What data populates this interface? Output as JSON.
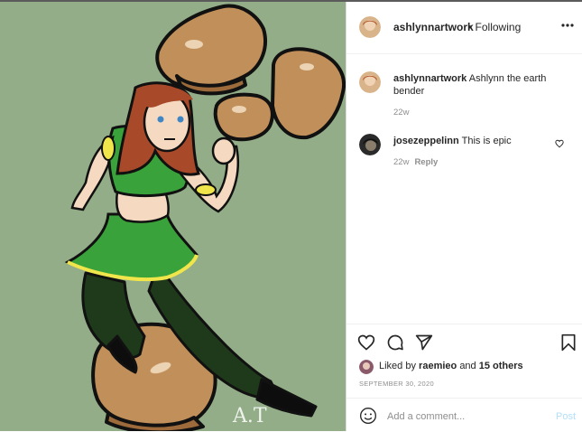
{
  "colors": {
    "art_background": "#93ad88",
    "link_blue_disabled": "#b2dffc",
    "muted_text": "#8e8e8e"
  },
  "header": {
    "username": "ashlynnartwork",
    "separator": "•",
    "follow_status": "Following",
    "more_icon": "more-horizontal-icon"
  },
  "artwork": {
    "signature": "A.T"
  },
  "comments": [
    {
      "username": "ashlynnartwork",
      "text": "Ashlynn the earth bender",
      "age": "22w",
      "reply_label": ""
    },
    {
      "username": "josezeppelinn",
      "text": "This is epic",
      "age": "22w",
      "reply_label": "Reply"
    }
  ],
  "actions": {
    "like_icon": "heart-icon",
    "comment_icon": "comment-icon",
    "share_icon": "share-icon",
    "save_icon": "bookmark-icon"
  },
  "likes": {
    "prefix": "Liked by",
    "user": "raemieo",
    "middle": "and",
    "others": "15 others"
  },
  "date": "SEPTEMBER 30, 2020",
  "comment_input": {
    "placeholder": "Add a comment...",
    "post_label": "Post"
  }
}
